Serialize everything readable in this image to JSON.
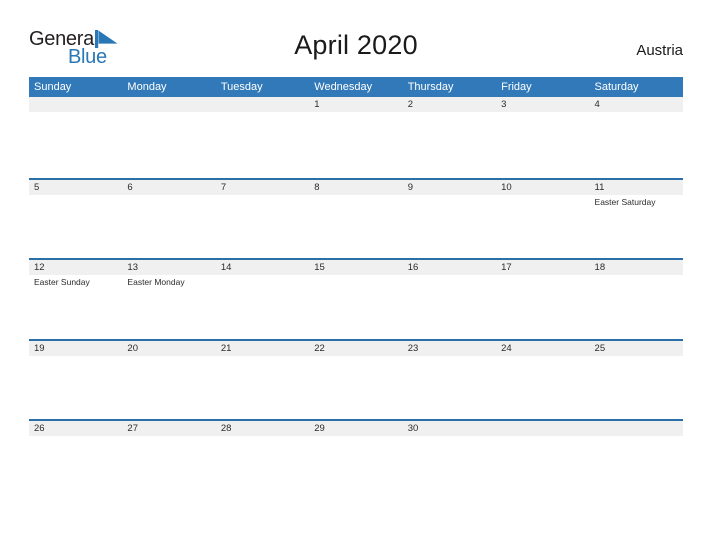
{
  "brand": {
    "name_part1": "General",
    "name_part2": "Blue",
    "logo_icon": "blue-flag-triangle-icon",
    "color_dark": "#231f20",
    "color_blue": "#2a77b5"
  },
  "header": {
    "title": "April 2020",
    "country": "Austria",
    "divider_color": "#2a6fa8"
  },
  "calendar": {
    "month": "April",
    "year": "2020",
    "header_bg": "#3179b8",
    "band_bg": "#f0f0f0",
    "row_border_color": "#2a6fa8",
    "weekdays": [
      "Sunday",
      "Monday",
      "Tuesday",
      "Wednesday",
      "Thursday",
      "Friday",
      "Saturday"
    ],
    "weeks": [
      [
        {
          "date": "",
          "event": ""
        },
        {
          "date": "",
          "event": ""
        },
        {
          "date": "",
          "event": ""
        },
        {
          "date": "1",
          "event": ""
        },
        {
          "date": "2",
          "event": ""
        },
        {
          "date": "3",
          "event": ""
        },
        {
          "date": "4",
          "event": ""
        }
      ],
      [
        {
          "date": "5",
          "event": ""
        },
        {
          "date": "6",
          "event": ""
        },
        {
          "date": "7",
          "event": ""
        },
        {
          "date": "8",
          "event": ""
        },
        {
          "date": "9",
          "event": ""
        },
        {
          "date": "10",
          "event": ""
        },
        {
          "date": "11",
          "event": "Easter Saturday"
        }
      ],
      [
        {
          "date": "12",
          "event": "Easter Sunday"
        },
        {
          "date": "13",
          "event": "Easter Monday"
        },
        {
          "date": "14",
          "event": ""
        },
        {
          "date": "15",
          "event": ""
        },
        {
          "date": "16",
          "event": ""
        },
        {
          "date": "17",
          "event": ""
        },
        {
          "date": "18",
          "event": ""
        }
      ],
      [
        {
          "date": "19",
          "event": ""
        },
        {
          "date": "20",
          "event": ""
        },
        {
          "date": "21",
          "event": ""
        },
        {
          "date": "22",
          "event": ""
        },
        {
          "date": "23",
          "event": ""
        },
        {
          "date": "24",
          "event": ""
        },
        {
          "date": "25",
          "event": ""
        }
      ],
      [
        {
          "date": "26",
          "event": ""
        },
        {
          "date": "27",
          "event": ""
        },
        {
          "date": "28",
          "event": ""
        },
        {
          "date": "29",
          "event": ""
        },
        {
          "date": "30",
          "event": ""
        },
        {
          "date": "",
          "event": ""
        },
        {
          "date": "",
          "event": ""
        }
      ]
    ]
  }
}
